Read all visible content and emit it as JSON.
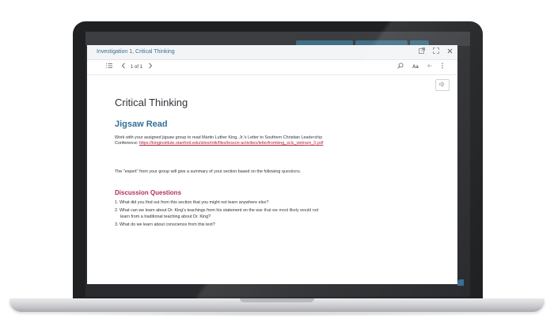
{
  "modal": {
    "title": "Investigation 1, Critical Thinking",
    "icons": {
      "open_new": "external-link-icon",
      "expand": "expand-icon",
      "close": "close-icon"
    }
  },
  "toolbar": {
    "page_indicator": "1 of 1",
    "font_label": "Aa",
    "icons": [
      "list-icon",
      "chevron-left-icon",
      "chevron-right-icon",
      "search-icon",
      "back-arrow-icon",
      "more-vertical-icon"
    ]
  },
  "document": {
    "title": "Critical Thinking",
    "section_heading": "Jigsaw Read",
    "intro_text": "Work with your assigned jigsaw group to read Martin Luther King, Jr.'s Letter to Southern Christian Leadership Conference:",
    "link_text": "https://kinginstitute.stanford.edu/sites/mlk/files/lesson-activities/letterfromking_sclc_vietnam_0.pdf",
    "expert_text": "The \"expert\" from your group will give a summary of your section based on the following questions.",
    "discussion_heading": "Discussion Questions",
    "questions": [
      "1.  What did you find out from this section that you might not learn anywhere else?",
      "2.  What can we learn about Dr. King's teachings from his statement on the war that we most likely would not learn from a traditional teaching about Dr. King?",
      "3. What do we learn about conscience from this text?"
    ]
  },
  "colors": {
    "accent": "#356f9a",
    "discussion": "#b0305a",
    "link": "#b0233b"
  }
}
